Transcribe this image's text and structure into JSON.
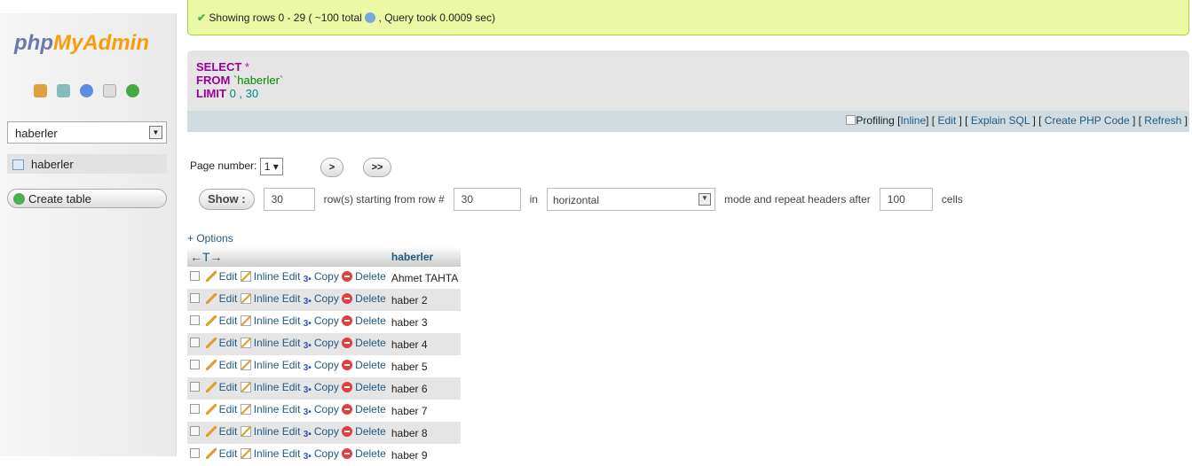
{
  "sidebar": {
    "logo_php": "php",
    "logo_myadmin": "MyAdmin",
    "db_select": "haberler",
    "table_item": "haberler",
    "create_table": "Create table"
  },
  "success": {
    "text": "Showing rows 0 - 29 ( ~100 total",
    "query": ", Query took 0.0009 sec)"
  },
  "sql": {
    "select": "SELECT",
    "star": "*",
    "from": "FROM",
    "table": "`haberler`",
    "limit": "LIMIT",
    "offset": "0",
    "comma": ",",
    "count": "30"
  },
  "sqlbar": {
    "profiling": "Profiling",
    "inline": "Inline",
    "edit": "Edit",
    "explain": "Explain SQL",
    "php": "Create PHP Code",
    "refresh": "Refresh"
  },
  "nav": {
    "page_label": "Page number:",
    "page": "1",
    "next": ">",
    "last": ">>",
    "show": "Show :",
    "rows": "30",
    "rows_label": "row(s) starting from row #",
    "start": "30",
    "in_label": "in",
    "mode": "horizontal",
    "mode_label": "mode and repeat headers after",
    "repeat": "100",
    "cells": "cells"
  },
  "options": "+ Options",
  "table": {
    "arrows": "←T→",
    "column": "haberler",
    "actions": {
      "edit": "Edit",
      "inline_edit": "Inline Edit",
      "copy": "Copy",
      "delete": "Delete"
    },
    "rows": [
      "Ahmet TAHTA",
      "haber 2",
      "haber 3",
      "haber 4",
      "haber 5",
      "haber 6",
      "haber 7",
      "haber 8",
      "haber 9"
    ]
  }
}
